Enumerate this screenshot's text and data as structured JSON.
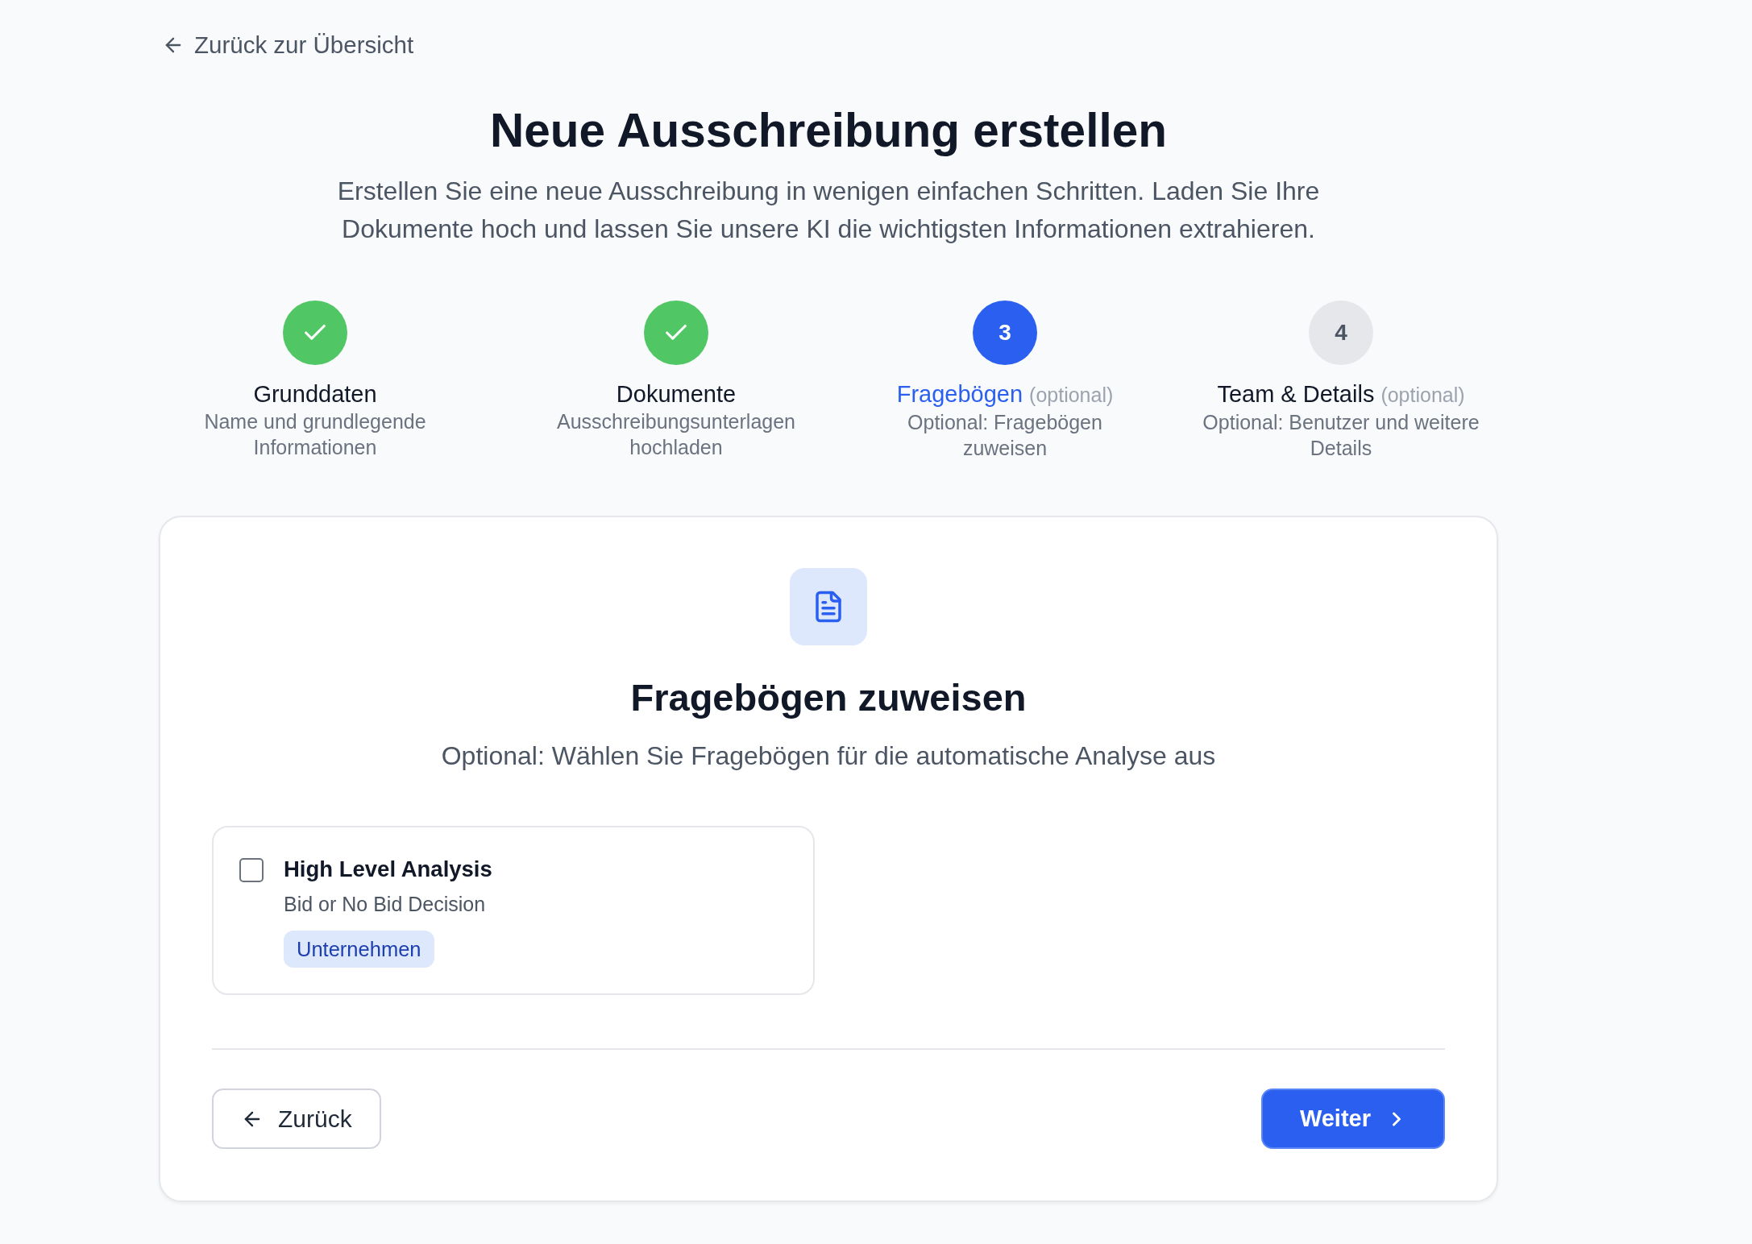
{
  "back_link": {
    "label": "Zurück zur Übersicht"
  },
  "header": {
    "title": "Neue Ausschreibung erstellen",
    "subtitle_lines": [
      "Erstellen Sie eine neue Ausschreibung in wenigen einfachen Schritten. Laden Sie Ihre",
      "Dokumente hoch und lassen Sie unsere KI die wichtigsten Informationen extrahieren."
    ]
  },
  "steps": [
    {
      "title": "Grunddaten",
      "description_lines": [
        "Name und grundlegende",
        "Informationen"
      ],
      "completed": true,
      "current": false
    },
    {
      "title": "Dokumente",
      "description_lines": [
        "Ausschreibungsunterlagen",
        "hochladen"
      ],
      "completed": true,
      "current": false
    },
    {
      "number": "3",
      "title": "Fragebögen",
      "note": "(optional)",
      "description_lines": [
        "Optional: Fragebögen",
        "zuweisen"
      ],
      "completed": false,
      "current": true
    },
    {
      "number": "4",
      "title": "Team & Details",
      "note": "(optional)",
      "description_lines": [
        "Optional: Benutzer und weitere",
        "Details"
      ],
      "completed": false,
      "current": false
    }
  ],
  "panel": {
    "title": "Fragebögen zuweisen",
    "subtitle": "Optional: Wählen Sie Fragebögen für die automatische Analyse aus",
    "questionnaires": [
      {
        "title": "High Level Analysis",
        "description": "Bid or No Bid Decision",
        "tag": "Unternehmen",
        "checked": false
      }
    ]
  },
  "footer": {
    "back_button": "Zurück",
    "next_button": "Weiter"
  }
}
